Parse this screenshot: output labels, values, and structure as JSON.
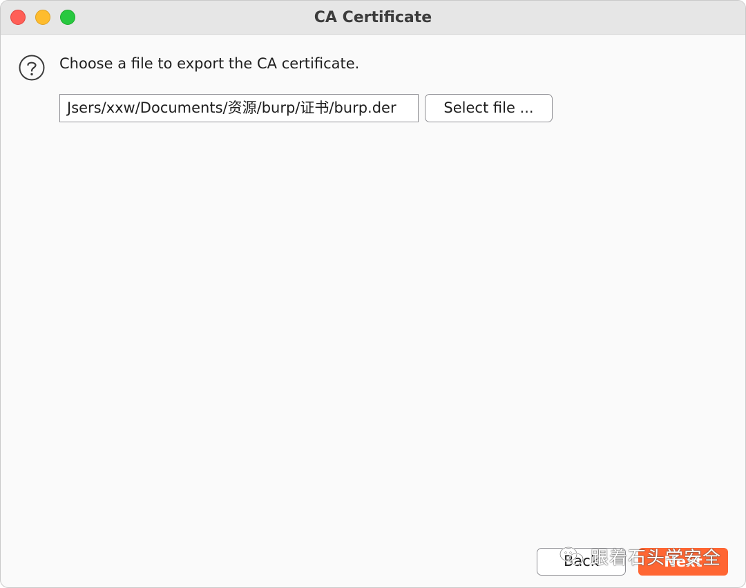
{
  "window": {
    "title": "CA Certificate"
  },
  "content": {
    "prompt": "Choose a file to export the CA certificate.",
    "file_path_value": "Jsers/xxw/Documents/资源/burp/证书/burp.der",
    "select_file_label": "Select file ..."
  },
  "footer": {
    "back_label": "Back",
    "next_label": "Next"
  },
  "watermark": {
    "text": "跟着石头学安全"
  },
  "icons": {
    "help": "question-circle-icon",
    "close": "close-traffic-light",
    "minimize": "minimize-traffic-light",
    "maximize": "maximize-traffic-light",
    "wechat": "wechat-icon"
  },
  "colors": {
    "accent": "#ff6633",
    "close": "#ff5f57",
    "minimize": "#febc2e",
    "maximize": "#28c840"
  }
}
